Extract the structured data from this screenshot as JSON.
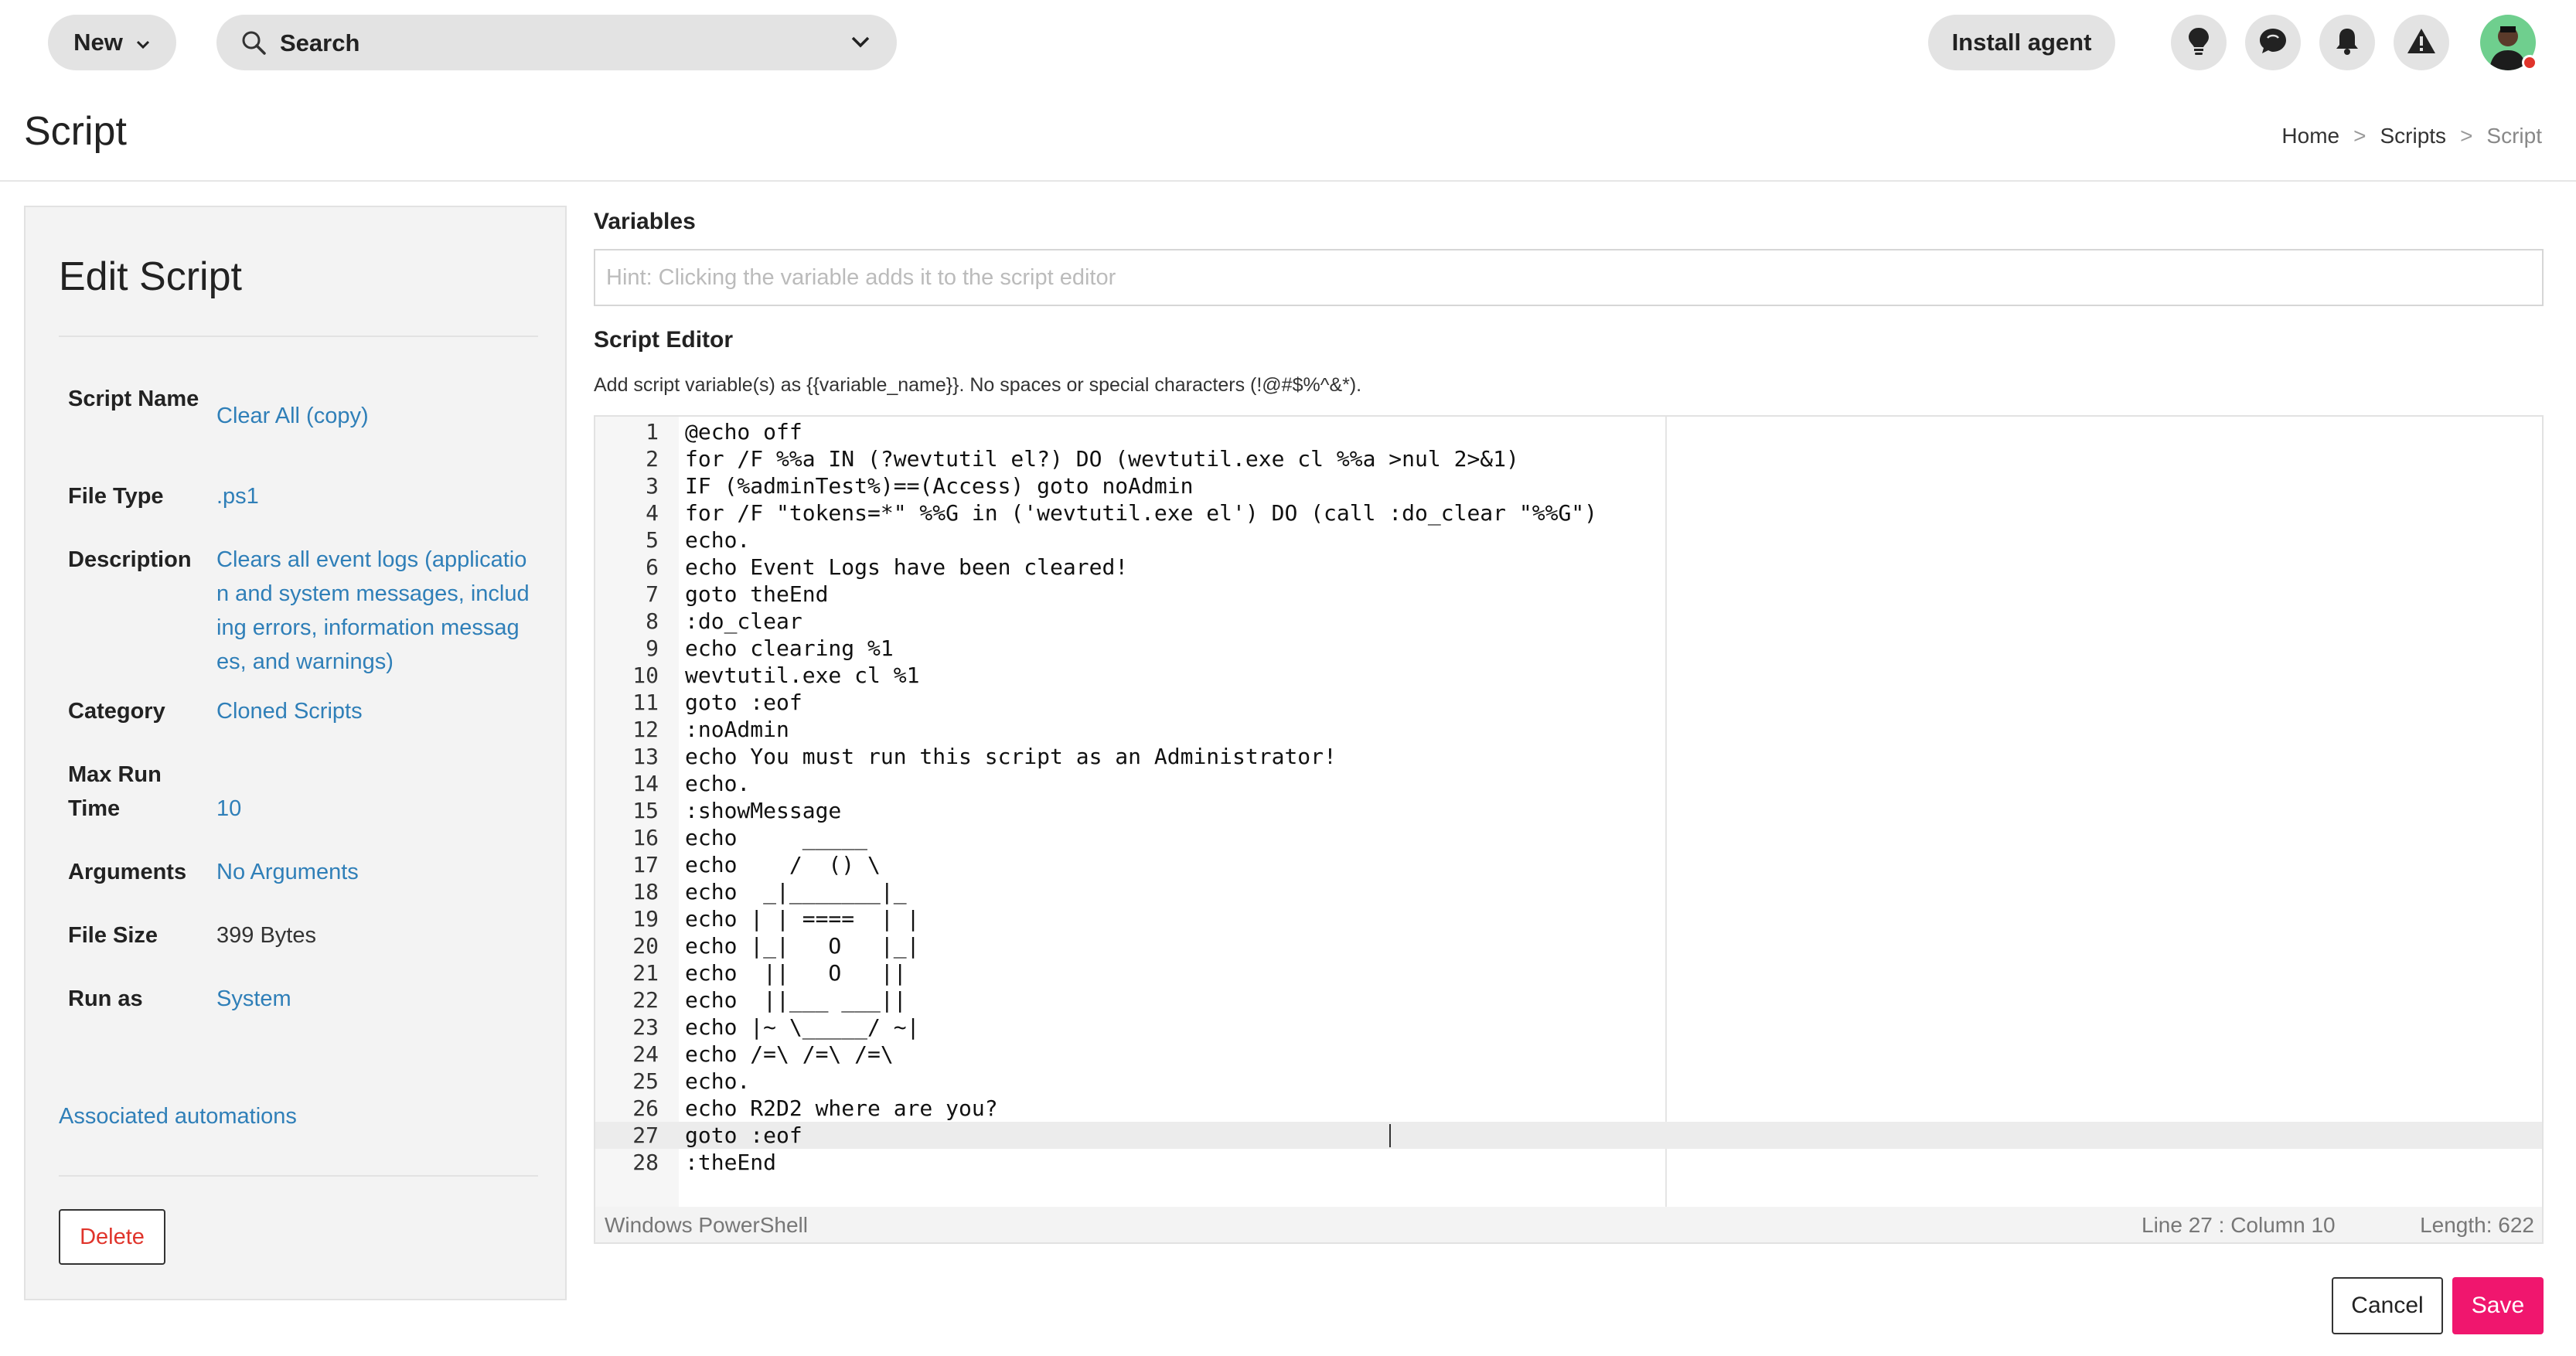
{
  "topbar": {
    "new_label": "New",
    "search_label": "Search",
    "install_label": "Install agent",
    "icons": [
      "lightbulb-icon",
      "chat-icon",
      "bell-icon",
      "warning-icon"
    ]
  },
  "page": {
    "title": "Script",
    "breadcrumb": [
      "Home",
      "Scripts",
      "Script"
    ]
  },
  "edit_panel": {
    "title": "Edit Script",
    "fields": [
      {
        "label": "Script Name",
        "value": "Clear All (copy)"
      },
      {
        "label": "File Type",
        "value": ".ps1"
      },
      {
        "label": "Description",
        "value": "Clears all event logs (application and system messages, including errors, information messages, and warnings)"
      },
      {
        "label": "Category",
        "value": "Cloned Scripts"
      },
      {
        "label": "Max Run Time",
        "value": "10"
      },
      {
        "label": "Arguments",
        "value": "No Arguments"
      },
      {
        "label": "File Size",
        "value": "399 Bytes"
      },
      {
        "label": "Run as",
        "value": "System"
      }
    ],
    "associated_link": "Associated automations",
    "delete_label": "Delete"
  },
  "variables": {
    "label": "Variables",
    "placeholder": "Hint: Clicking the variable adds it to the script editor"
  },
  "editor": {
    "label": "Script Editor",
    "hint": "Add script variable(s) as {{variable_name}}. No spaces or special characters (!@#$%^&*).",
    "lines": [
      "@echo off",
      "for /F %%a IN (?wevtutil el?) DO (wevtutil.exe cl %%a >nul 2>&1)",
      "IF (%adminTest%)==(Access) goto noAdmin",
      "for /F \"tokens=*\" %%G in ('wevtutil.exe el') DO (call :do_clear \"%%G\")",
      "echo.",
      "echo Event Logs have been cleared!",
      "goto theEnd",
      ":do_clear",
      "echo clearing %1",
      "wevtutil.exe cl %1",
      "goto :eof",
      ":noAdmin",
      "echo You must run this script as an Administrator!",
      "echo.",
      ":showMessage",
      "echo     _____",
      "echo    /  () \\",
      "echo  _|_______|_",
      "echo | | ====  | |",
      "echo |_|   O   |_|",
      "echo  ||   O   ||",
      "echo  ||___ ___||",
      "echo |~ \\_____/ ~|",
      "echo /=\\ /=\\ /=\\",
      "echo.",
      "echo R2D2 where are you?",
      "goto :eof",
      ":theEnd"
    ],
    "active_line": 27,
    "mode": "Windows PowerShell",
    "position": "Line 27 : Column 10",
    "length": "Length: 622"
  },
  "actions": {
    "cancel_label": "Cancel",
    "save_label": "Save"
  },
  "colors": {
    "accent": "#f0166e",
    "link": "#2f7fb8",
    "danger": "#e0342b"
  }
}
